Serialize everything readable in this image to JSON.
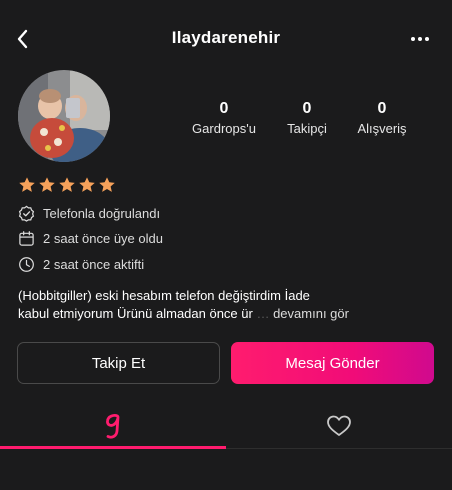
{
  "header": {
    "title": "Ilaydarenehir",
    "back_icon": "chevron-left-icon",
    "more_icon": "more-horizontal-icon"
  },
  "profile": {
    "avatar_icon": "profile-photo"
  },
  "stats": [
    {
      "value": "0",
      "label": "Gardrops'u"
    },
    {
      "value": "0",
      "label": "Takipçi"
    },
    {
      "value": "0",
      "label": "Alışveriş"
    }
  ],
  "rating": {
    "stars": 5,
    "max": 5,
    "color": "#f6a15a"
  },
  "info": [
    {
      "icon": "verified-badge-icon",
      "text": "Telefonla doğrulandı"
    },
    {
      "icon": "calendar-icon",
      "text": "2 saat önce üye oldu"
    },
    {
      "icon": "clock-icon",
      "text": "2 saat önce aktifti"
    }
  ],
  "bio": {
    "line1": "(Hobbitgiller) eski hesabım telefon değiştirdim İade",
    "line2": "kabul etmiyorum Ürünü almadan önce ür",
    "more_label": "devamını gör"
  },
  "actions": {
    "follow_label": "Takip Et",
    "message_label": "Mesaj Gönder",
    "accent": "#ff1c6e"
  },
  "tabs": [
    {
      "icon": "gardrops-g-icon",
      "active": true
    },
    {
      "icon": "heart-icon",
      "active": false
    }
  ]
}
